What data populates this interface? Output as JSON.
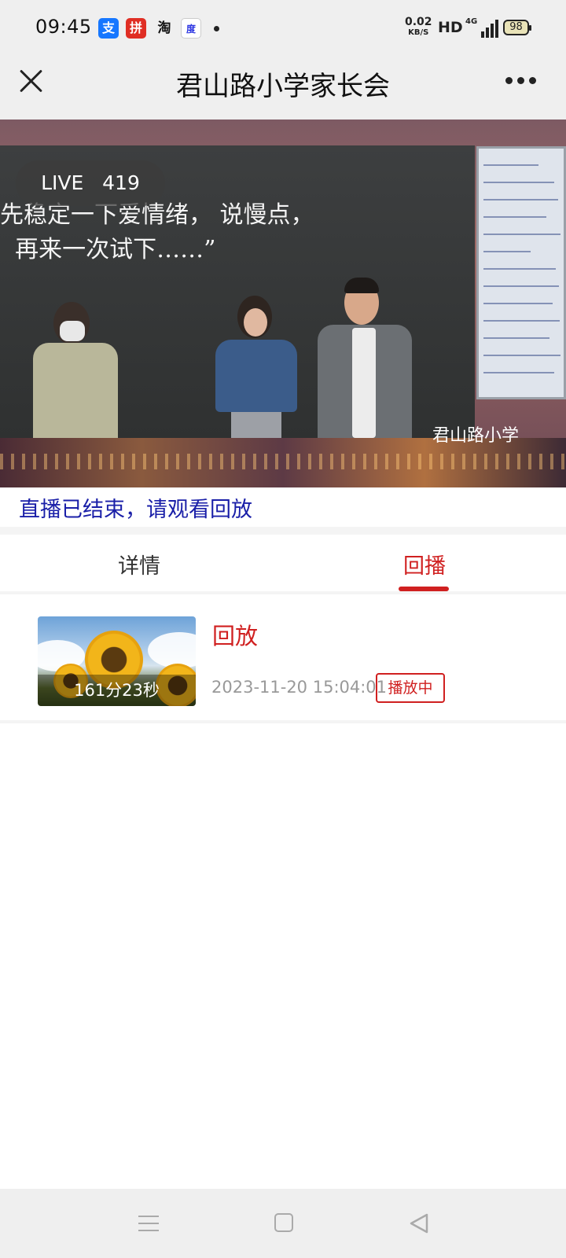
{
  "status_bar": {
    "time": "09:45",
    "app_icons": [
      "alipay-icon",
      "pinduoduo-icon",
      "taobao-icon",
      "baidu-icon"
    ],
    "alipay_glyph": "支",
    "pdd_glyph": "拼",
    "taobao_glyph": "淘",
    "baidu_glyph": "度",
    "speed_value": "0.02",
    "speed_unit": "KB/S",
    "hd": "HD",
    "network": "4G",
    "battery": "98"
  },
  "header": {
    "title": "君山路小学家长会"
  },
  "video": {
    "live_label": "LIVE",
    "viewers": "419",
    "board_line1": "先稳定一下爱情绪， 说慢点，",
    "board_line2": "  再来一次试下……”",
    "watermark": "君山路小学"
  },
  "notice": "直播已结束，请观看回放",
  "tabs": [
    {
      "label": "详情",
      "active": false
    },
    {
      "label": "回播",
      "active": true
    }
  ],
  "replay": {
    "title": "回放",
    "duration": "161分23秒",
    "datetime": "2023-11-20 15:04:01",
    "status": "播放中"
  },
  "colors": {
    "accent": "#d02020",
    "notice": "#1a1fa8",
    "bar_bg": "#efefef"
  }
}
